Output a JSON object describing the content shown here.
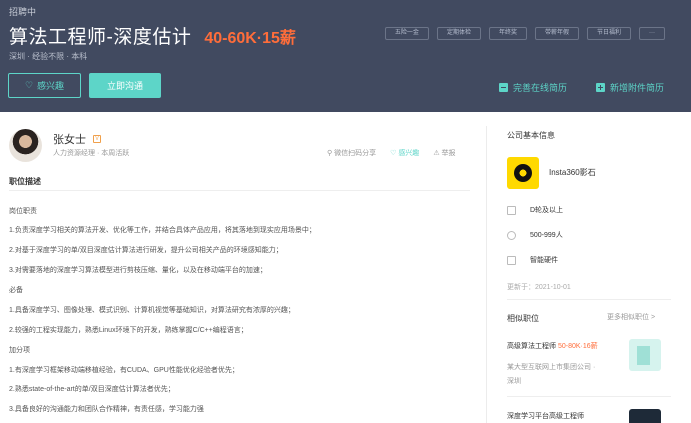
{
  "header": {
    "status": "招聘中",
    "job_title": "算法工程师-深度估计",
    "salary": "40-60K·15薪",
    "meta": "深圳 · 经验不限 · 本科",
    "tags": [
      "五险一金",
      "定期体检",
      "年终奖",
      "带薪年假",
      "节日福利",
      "···"
    ],
    "like_label": "感兴趣",
    "chat_label": "立即沟通",
    "complete_resume": "完善在线简历",
    "add_attachment": "新增附件简历"
  },
  "recruiter": {
    "name": "张女士",
    "badge": "V",
    "role": "人力资源经理 · 本周活跃",
    "share": "微信扫码分享",
    "like": "感兴趣",
    "report": "举报"
  },
  "description": {
    "section_title": "职位描述",
    "lines": [
      "岗位职责",
      "1.负责深度学习相关的算法开发、优化等工作，并结合具体产品应用，将其落地到现实应用场景中；",
      "2.对基于深度学习的单/双目深度估计算法进行研发，提升公司相关产品的环境感知能力；",
      "3.对需要落地的深度学习算法模型进行剪枝压缩、量化，以及在移动端平台的加速；",
      "必备",
      "1.具备深度学习、图像处理、模式识别、计算机视觉等基础知识，对算法研究有浓厚的兴趣；",
      "2.较强的工程实现能力，熟悉Linux环境下的开发，熟练掌握C/C++编程语言；",
      "加分项",
      "1.有深度学习框架移动端移植经验，有CUDA、GPU性能优化经验者优先；",
      "2.熟悉state-of-the-art的单/双目深度估计算法者优先；",
      "3.具备良好的沟通能力和团队合作精神，有责任感，学习能力强"
    ]
  },
  "company": {
    "section_title": "公司基本信息",
    "name": "Insta360影石",
    "funding": "D轮及以上",
    "size": "500-999人",
    "industry": "智能硬件",
    "updated": "更新于：2021-10-01"
  },
  "related": {
    "section_title": "相似职位",
    "more": "更多相似职位 >",
    "jobs": [
      {
        "title": "高级算法工程师",
        "salary": "50-80K·16薪",
        "company": "某大型互联网上市集团公司 ·",
        "city": "深圳"
      },
      {
        "title": "深度学习平台高级工程师",
        "salary": "",
        "company": "",
        "city": ""
      }
    ]
  }
}
